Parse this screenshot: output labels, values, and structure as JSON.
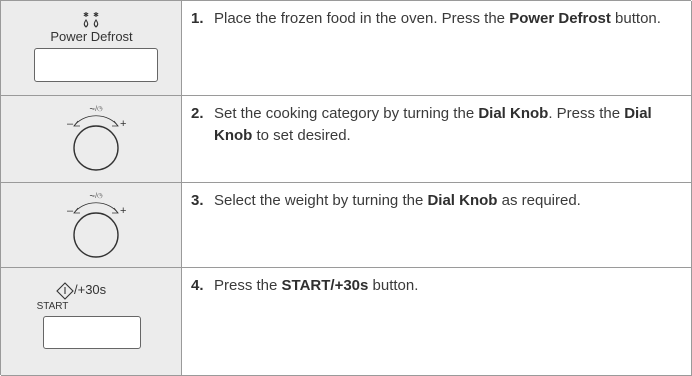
{
  "steps": [
    {
      "number": "1.",
      "text_1": "Place the frozen food in the oven. Press the ",
      "bold_1": "Power Defrost",
      "text_2": " button.",
      "icon": "power-defrost-button",
      "icon_label": "Power Defrost"
    },
    {
      "number": "2.",
      "text_1": "Set the cooking category by turning the ",
      "bold_1": "Dial Knob",
      "text_2": ". Press the ",
      "bold_2": "Dial Knob",
      "text_3": " to set desired.",
      "icon": "dial-knob",
      "dial_minus": "–",
      "dial_plus": "+"
    },
    {
      "number": "3.",
      "text_1": "Select the weight by turning the ",
      "bold_1": "Dial Knob",
      "text_2": " as required.",
      "icon": "dial-knob",
      "dial_minus": "–",
      "dial_plus": "+"
    },
    {
      "number": "4.",
      "text_1": "Press the ",
      "bold_1": "START/+30s",
      "text_2": " button.",
      "icon": "start-button",
      "icon_label_top": "/+30s",
      "icon_label": "START"
    }
  ],
  "colors": {
    "icon_cell_bg": "#ececec",
    "border": "#9a9a9a",
    "text": "#3a3a3a"
  }
}
